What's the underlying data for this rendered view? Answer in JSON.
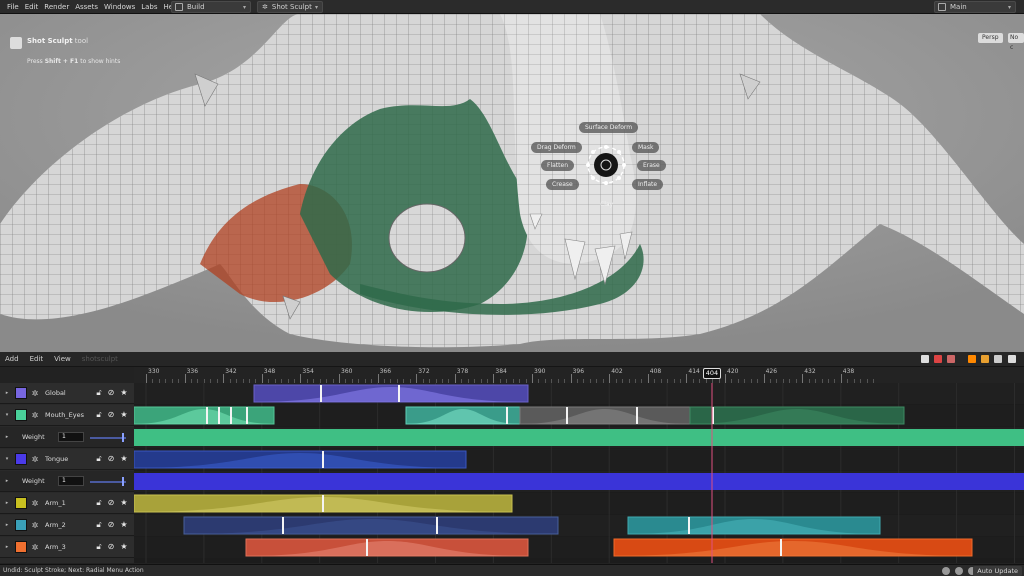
{
  "menubar": {
    "items": [
      "File",
      "Edit",
      "Render",
      "Assets",
      "Windows",
      "Labs",
      "Help"
    ],
    "desktop": "Build",
    "shelf": "Shot Sculpt",
    "context": "Main"
  },
  "viewport": {
    "tool_title": "Shot Sculpt",
    "tool_title_suffix": " tool",
    "hint_prefix": "Press ",
    "hint_key": "Shift + F1",
    "hint_suffix": " to show hints",
    "camera_button": "Persp",
    "display_button": "No c"
  },
  "radial_menu": {
    "top": "Surface Deform",
    "left_items": [
      "Drag Deform",
      "Flatten",
      "Crease"
    ],
    "right_items": [
      "Mask",
      "Erase",
      "Inflate"
    ],
    "bottom": "Clay"
  },
  "panel": {
    "menu": [
      "Add",
      "Edit",
      "View"
    ],
    "panel_name": "shotsculpt"
  },
  "ruler": {
    "labels": [
      "330",
      "336",
      "342",
      "348",
      "354",
      "360",
      "366",
      "372",
      "378",
      "384",
      "390",
      "396",
      "402",
      "408",
      "414",
      "420",
      "426",
      "432",
      "438"
    ],
    "playhead": "404"
  },
  "tracks": [
    {
      "type": "layer",
      "name": "Global",
      "color": "#7766e0",
      "arrow": "▸"
    },
    {
      "type": "layer",
      "name": "Mouth_Eyes",
      "color": "#4ad19a",
      "arrow": "▾"
    },
    {
      "type": "weight",
      "label": "Weight",
      "value": "1"
    },
    {
      "type": "layer",
      "name": "Tongue",
      "color": "#4a3ae8",
      "arrow": "▾"
    },
    {
      "type": "weight",
      "label": "Weight",
      "value": "1"
    },
    {
      "type": "layer",
      "name": "Arm_1",
      "color": "#c8c020",
      "arrow": "▸"
    },
    {
      "type": "layer",
      "name": "Arm_2",
      "color": "#3aa0b8",
      "arrow": "▸"
    },
    {
      "type": "layer",
      "name": "Arm_3",
      "color": "#f07030",
      "arrow": "▸"
    }
  ],
  "status": {
    "text": "Undid: Sculpt Stroke; Next: Radial Menu Action",
    "auto_update": "Auto Update"
  },
  "colors": {
    "playhead": "#e05080",
    "mesh_green": "#2f6a4a",
    "mesh_red": "#b04020"
  }
}
